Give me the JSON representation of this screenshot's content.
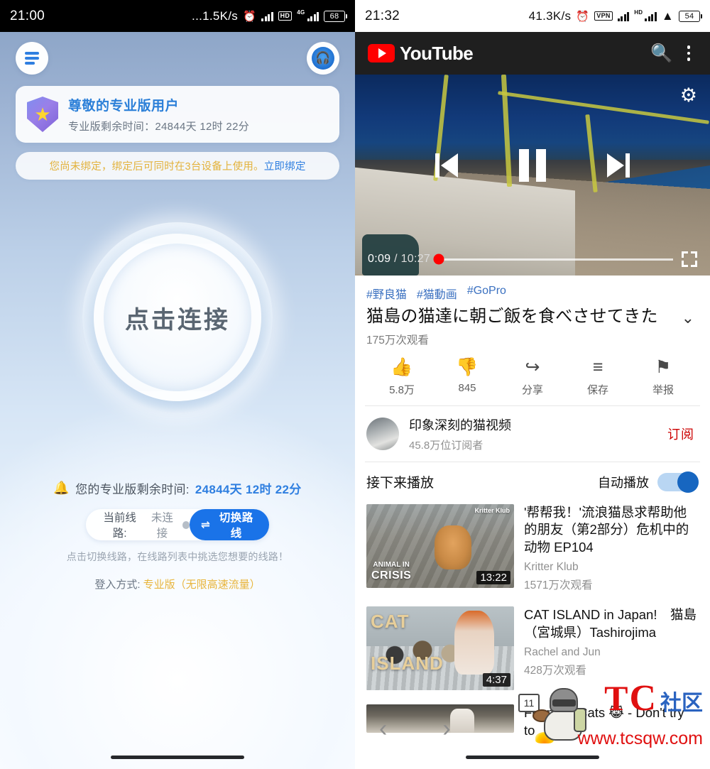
{
  "left": {
    "statusbar": {
      "time": "21:00",
      "speed": "...1.5K/s",
      "alarm_icon": "alarm-icon",
      "hd_label": "HD",
      "net_label": "4G",
      "battery": "68"
    },
    "header": {
      "menu_icon": "menu-icon",
      "support_icon": "headset-icon"
    },
    "vip_card": {
      "badge_icon": "shield-star-icon",
      "title": "尊敬的专业版用户",
      "subtitle": "专业版剩余时间：24844天 12时 22分"
    },
    "bind_notice": {
      "text": "您尚未绑定，绑定后可同时在3台设备上使用。",
      "link": "立即绑定"
    },
    "connect": {
      "label": "点击连接"
    },
    "remaining": {
      "bell_icon": "bell-icon",
      "prefix": "您的专业版剩余时间:",
      "value": "24844天 12时 22分"
    },
    "route": {
      "label": "当前线路:",
      "value": "未连接",
      "switch_icon": "swap-icon",
      "switch_label": "切换路线"
    },
    "hint": "点击切换线路，在线路列表中挑选您想要的线路！",
    "login_mode": {
      "label": "登入方式:",
      "value": "专业版（无限高速流量）"
    }
  },
  "right": {
    "statusbar": {
      "time": "21:32",
      "speed": "41.3K/s",
      "alarm_icon": "alarm-icon",
      "vpn_label": "VPN",
      "hd_label": "HD",
      "wifi_icon": "wifi-icon",
      "battery": "54"
    },
    "header": {
      "logo_text": "YouTube",
      "search_icon": "search-icon",
      "menu_icon": "kebab-menu-icon"
    },
    "player": {
      "settings_icon": "gear-icon",
      "prev_icon": "previous-icon",
      "pause_icon": "pause-icon",
      "next_icon": "next-icon",
      "current_time": "0:09",
      "separator": "/",
      "duration": "10:27",
      "fullscreen_icon": "fullscreen-icon",
      "progress_percent": 1.5
    },
    "video": {
      "tags": [
        "#野良猫",
        "#猫動画",
        "#GoPro"
      ],
      "title": "猫島の猫達に朝ご飯を食べさせてきた",
      "expand_icon": "chevron-down-icon",
      "views": "175万次观看",
      "actions": [
        {
          "icon": "thumbs-up-icon",
          "glyph": "👍",
          "label": "5.8万"
        },
        {
          "icon": "thumbs-down-icon",
          "glyph": "👎",
          "label": "845"
        },
        {
          "icon": "share-icon",
          "glyph": "↪",
          "label": "分享"
        },
        {
          "icon": "save-playlist-icon",
          "glyph": "≡",
          "label": "保存"
        },
        {
          "icon": "report-flag-icon",
          "glyph": "⚑",
          "label": "举报"
        }
      ]
    },
    "channel": {
      "avatar_icon": "channel-avatar",
      "name": "印象深刻的猫视频",
      "subscribers": "45.8万位订阅者",
      "subscribe_label": "订阅"
    },
    "upnext": {
      "title": "接下来播放",
      "autoplay_label": "自动播放",
      "autoplay_on": true,
      "items": [
        {
          "title": "'帮帮我！'流浪猫恳求帮助他的朋友（第2部分）危机中的动物 EP104",
          "channel": "Kritter Klub",
          "views": "1571万次观看",
          "duration": "13:22",
          "thumb_overlay_top": "Kritter Klub",
          "thumb_overlay_line1": "ANIMAL IN",
          "thumb_overlay_line2": "CRISIS"
        },
        {
          "title": "CAT ISLAND in Japan!　猫島（宮城県）Tashirojima",
          "channel": "Rachel and Jun",
          "views": "428万次观看",
          "duration": "4:37",
          "thumb_overlay_line1": "CAT",
          "thumb_overlay_line2": "ISLAND"
        },
        {
          "title": "Funniest Cats 😹 - Don't try to",
          "channel": "",
          "views": "",
          "duration": ""
        }
      ]
    },
    "nav": {
      "back_icon": "chevron-left-icon",
      "forward_icon": "chevron-right-icon"
    },
    "watermark": {
      "brand_t": "T",
      "brand_c": "C",
      "brand_cn": "社区",
      "url": "www.tcsqw.com",
      "sign_number": "11"
    }
  }
}
